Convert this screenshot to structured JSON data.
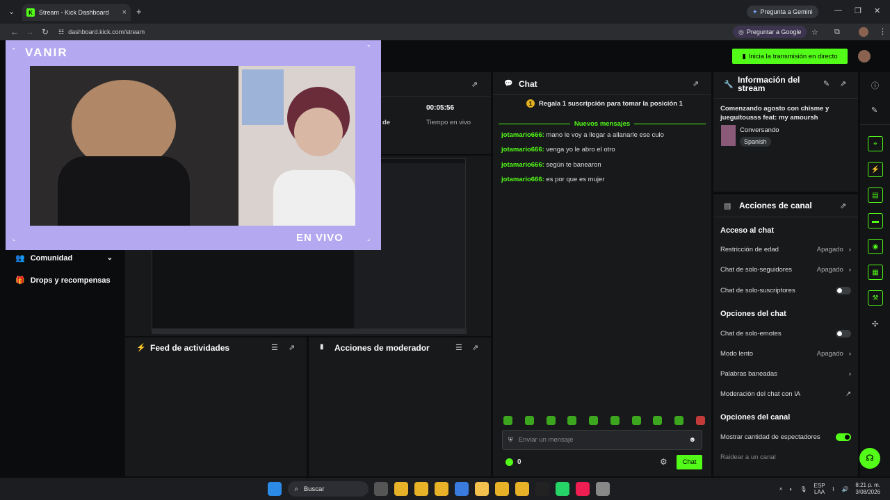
{
  "browser": {
    "tab_title": "Stream - Kick Dashboard",
    "url": "dashboard.kick.com/stream",
    "gemini_label": "Pregunta a Gemini",
    "google_ask_label": "Preguntar a Google"
  },
  "header": {
    "go_live_label": "Inicia la transmisión en directo"
  },
  "overlay": {
    "title": "VANIR",
    "live_label": "EN VIVO"
  },
  "stats": {
    "time_value": "00:05:56",
    "time_label": "Tiempo en vivo",
    "partial_label": "de"
  },
  "sidebar": {
    "items": [
      {
        "label": "Comunidad"
      },
      {
        "label": "Drops y recompensas"
      }
    ]
  },
  "panels": {
    "activity_feed_title": "Feed de actividades",
    "mod_actions_title": "Acciones de moderador"
  },
  "chat": {
    "title": "Chat",
    "gift_banner": "Regala 1 suscripción para tomar la posición 1",
    "new_messages": "Nuevos mensajes",
    "messages": [
      {
        "user": "jotamario666:",
        "text": "mano le voy a llegar a allanarle ese culo"
      },
      {
        "user": "jotamario666:",
        "text": "venga yo le abro el otro"
      },
      {
        "user": "jotamario666:",
        "text": "según te banearon"
      },
      {
        "user": "jotamario666:",
        "text": "es por que es mujer"
      }
    ],
    "input_placeholder": "Enviar un mensaje",
    "points": "0",
    "send_label": "Chat"
  },
  "stream_info": {
    "title": "Información del stream",
    "stream_title": "Comenzando agosto con chisme y jueguitousss feat: my amoursh",
    "category": "Conversando",
    "language": "Spanish"
  },
  "channel_actions": {
    "title": "Acciones de canal",
    "chat_access_section": "Acceso al chat",
    "age_restriction": "Restricción de edad",
    "age_restriction_value": "Apagado",
    "followers_only": "Chat de solo-seguidores",
    "followers_only_value": "Apagado",
    "subs_only": "Chat de solo-suscriptores",
    "chat_options_section": "Opciones del chat",
    "emotes_only": "Chat de solo-emotes",
    "slow_mode": "Modo lento",
    "slow_mode_value": "Apagado",
    "banned_words": "Palabras baneadas",
    "ai_moderation": "Moderación del chat con IA",
    "channel_options_section": "Opciones del canal",
    "show_viewers": "Mostrar cantidad de espectadores",
    "raid": "Raidear a un canal"
  },
  "taskbar": {
    "search_label": "Buscar",
    "lang": "ESP",
    "lang2": "LAA",
    "time": "8:21 p. m.",
    "date": "3/08/2026"
  },
  "colors": {
    "accent": "#53fc18",
    "panel": "#17191b",
    "overlay": "#b4a8f0"
  }
}
